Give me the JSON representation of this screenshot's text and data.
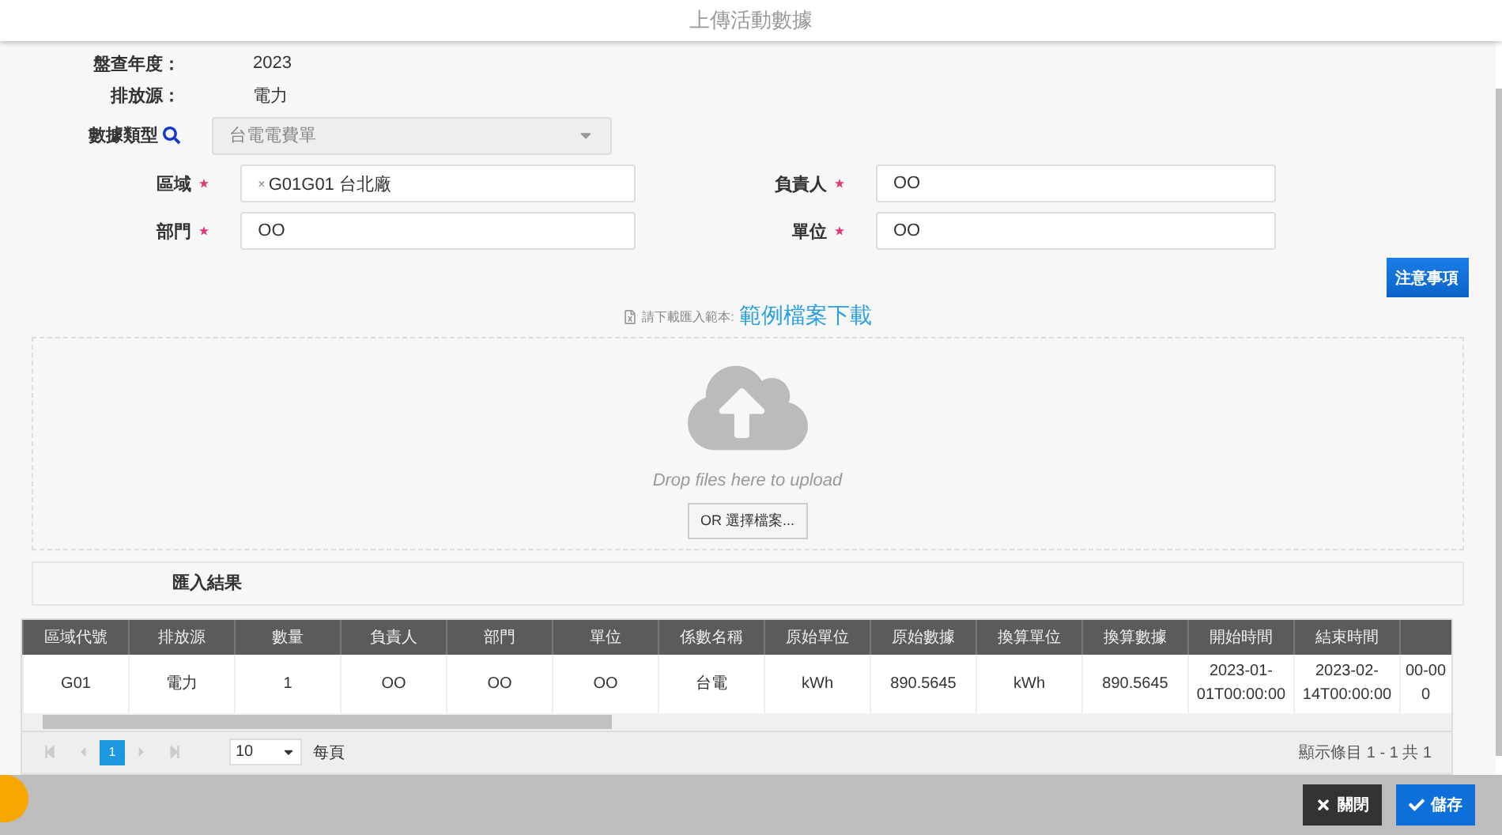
{
  "window": {
    "title": "上傳活動數據"
  },
  "info": [
    {
      "label": "盤查年度：",
      "value": "2023"
    },
    {
      "label": "排放源：",
      "value": "電力"
    }
  ],
  "data_type": {
    "label": "數據類型",
    "value": "台電電費單",
    "disabled": true
  },
  "fields": [
    {
      "label": "區域",
      "required": true,
      "tag": "G01G01 台北廠",
      "tag_remove": "×"
    },
    {
      "label": "負責人",
      "required": true,
      "value": "OO"
    },
    {
      "label": "部門",
      "required": true,
      "value": "OO"
    },
    {
      "label": "單位",
      "required": true,
      "value": "OO"
    }
  ],
  "notice_button": "注意事項",
  "template": {
    "hint": "請下載匯入範本:",
    "link": "範例檔案下載"
  },
  "upload": {
    "prompt": "Drop files here to upload",
    "button": "OR 選擇檔案..."
  },
  "result_title": "匯入結果",
  "table": {
    "columns": [
      "區域代號",
      "排放源",
      "數量",
      "負責人",
      "部門",
      "單位",
      "係數名稱",
      "原始單位",
      "原始數據",
      "換算單位",
      "換算數據",
      "開始時間",
      "結束時間",
      ""
    ],
    "rows": [
      [
        "G01",
        "電力",
        "1",
        "OO",
        "OO",
        "OO",
        "台電",
        "kWh",
        "890.5645",
        "kWh",
        "890.5645",
        "2023-01-01T00:00:00",
        "2023-02-14T00:00:00",
        "00-00 0"
      ]
    ]
  },
  "pager": {
    "pages": [
      {
        "label": "1",
        "selected": true
      }
    ],
    "page_size": "10",
    "per_page": "每頁",
    "summary": "顯示條目 1 - 1 共 1"
  },
  "footer": {
    "close": "關閉",
    "save": "儲存"
  }
}
